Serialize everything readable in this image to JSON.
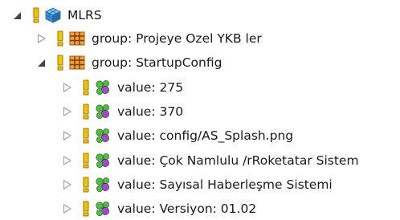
{
  "tree": {
    "root": {
      "label": "MLRS",
      "expanded": true
    },
    "nodes": [
      {
        "label": "group: Projeye Ozel YKB ler",
        "kind": "group",
        "expanded": false
      },
      {
        "label": "group: StartupConfig",
        "kind": "group",
        "expanded": true
      },
      {
        "label": "value: 275",
        "kind": "value",
        "expanded": false
      },
      {
        "label": "value: 370",
        "kind": "value",
        "expanded": false
      },
      {
        "label": "value: config/AS_Splash.png",
        "kind": "value",
        "expanded": false
      },
      {
        "label": "value: Çok Namlulu /rRoketatar Sistem",
        "kind": "value",
        "expanded": false
      },
      {
        "label": "value: Sayısal Haberleşme Sistemi",
        "kind": "value",
        "expanded": false
      },
      {
        "label": "value: Versiyon: 01.02",
        "kind": "value",
        "expanded": false
      }
    ]
  },
  "icons": {
    "root": "package-cube-icon",
    "group": "grid-group-icon",
    "value": "molecule-value-icon",
    "marker": "exclamation-marker-icon"
  },
  "colors": {
    "marker": "#e2b000",
    "group_icon": "#e08a1e",
    "root_icon": "#3a8fd6",
    "value_green": "#4caf3a",
    "value_purple": "#8e44ad"
  }
}
